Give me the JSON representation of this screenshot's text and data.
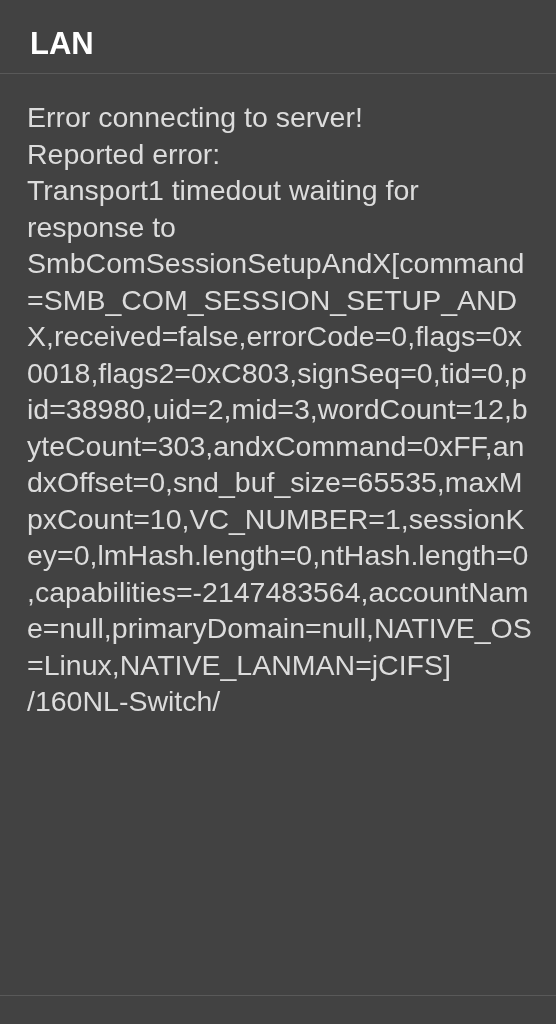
{
  "dialog": {
    "title": "LAN",
    "message": "Error connecting to server!\nReported error:\nTransport1 timedout waiting for response to SmbComSessionSetupAndX[command=SMB_COM_SESSION_SETUP_ANDX,received=false,errorCode=0,flags=0x0018,flags2=0xC803,signSeq=0,tid=0,pid=38980,uid=2,mid=3,wordCount=12,byteCount=303,andxCommand=0xFF,andxOffset=0,snd_buf_size=65535,maxMpxCount=10,VC_NUMBER=1,sessionKey=0,lmHash.length=0,ntHash.length=0,capabilities=-2147483564,accountName=null,primaryDomain=null,NATIVE_OS=Linux,NATIVE_LANMAN=jCIFS]\n/160NL-Switch/"
  }
}
